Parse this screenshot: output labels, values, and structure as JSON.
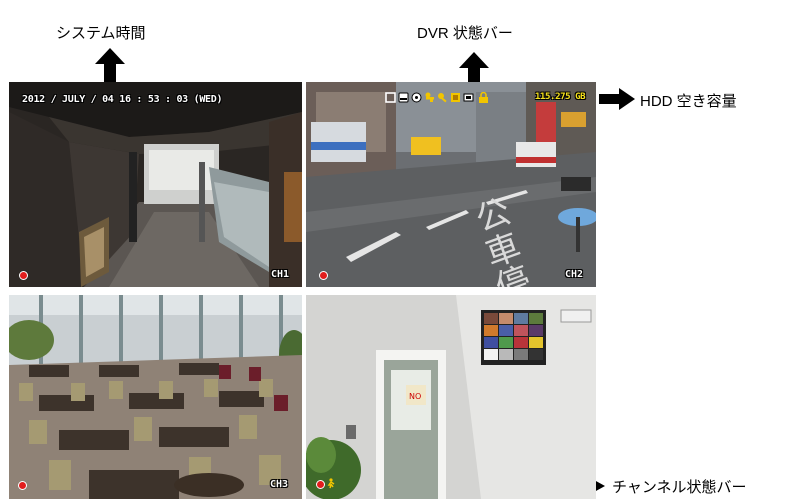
{
  "annotations": {
    "system_time": "システム時間",
    "dvr_status_bar": "DVR 状態バー",
    "hdd_free_space": "HDD 空き容量",
    "channel_status_bar": "チャンネル状態バー"
  },
  "osd": {
    "datetime": "2012 / JULY / 04  16 : 53 : 03 (WED)",
    "hdd_capacity": "115.275 GB",
    "status_icons": [
      "network-icon",
      "hdd-icon",
      "disc-icon",
      "user-key-icon",
      "key-lock-icon",
      "alarm-icon",
      "usb-icon",
      "lock-icon"
    ]
  },
  "channels": [
    {
      "label": "CH1",
      "recording": true
    },
    {
      "label": "CH2",
      "recording": true
    },
    {
      "label": "CH3",
      "recording": true
    },
    {
      "label": "",
      "recording": true,
      "motion": true
    }
  ],
  "colors": {
    "rec_dot": "#e21d1d",
    "hdd_text": "#f6e21c",
    "status_yellow": "#f2c500"
  }
}
